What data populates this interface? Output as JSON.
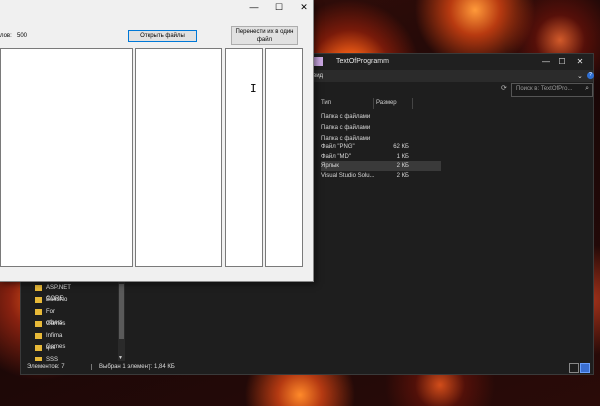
{
  "app": {
    "files_label": "лов:",
    "files_count": "500",
    "open_button": "Открыть файлы",
    "merge_button": "Перенести их в один файл",
    "controls": {
      "minimize": "—",
      "maximize": "☐",
      "close": "✕"
    }
  },
  "explorer": {
    "title": "TextOfProgramm",
    "ribbon_label": "вид",
    "controls": {
      "minimize": "—",
      "maximize": "☐",
      "close": "✕"
    },
    "search_placeholder": "Поиск в: TextOfPro...",
    "columns": {
      "type": "Тип",
      "size": "Размер"
    },
    "files": [
      {
        "type": "Папка с файлами",
        "size": ""
      },
      {
        "type": "Папка с файлами",
        "size": ""
      },
      {
        "type": "Папка с файлами",
        "size": ""
      },
      {
        "type": "Файл \"PNG\"",
        "size": "62 КБ"
      },
      {
        "type": "Файл \"MD\"",
        "size": "1 КБ"
      },
      {
        "type": "Ярлык",
        "size": "2 КБ"
      },
      {
        "type": "Visual Studio Solu...",
        "size": "2 КБ"
      }
    ],
    "nav_items": [
      "ASP.NET CORE",
      "BokuNo",
      "For others",
      "Games",
      "Infima Games",
      "qss",
      "SSS"
    ],
    "status": {
      "elements": "Элементов: 7",
      "selected": "Выбран 1 элемент: 1,84 КБ"
    }
  },
  "colors": {
    "explorer_bg": "#1e1e1e",
    "app_bg": "#f0f0f0",
    "folder": "#e8b938",
    "accent": "#0078d7"
  }
}
